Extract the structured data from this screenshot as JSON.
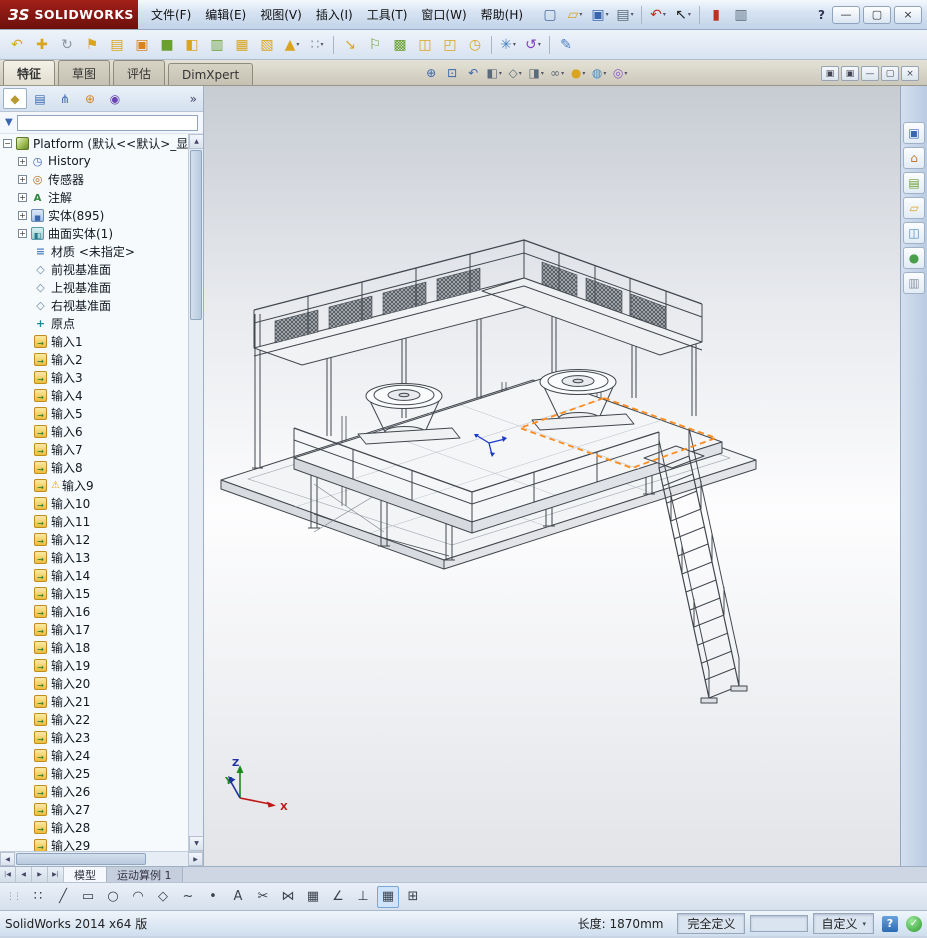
{
  "window": {
    "logo_mark": "ЗS",
    "logo_text": "SOLIDWORKS",
    "menus": [
      {
        "label": "文件(F)"
      },
      {
        "label": "编辑(E)"
      },
      {
        "label": "视图(V)"
      },
      {
        "label": "插入(I)"
      },
      {
        "label": "工具(T)"
      },
      {
        "label": "窗口(W)"
      },
      {
        "label": "帮助(H)"
      }
    ],
    "toolbar": [
      {
        "name": "new-file-icon",
        "glyph": "▢",
        "color": "#4a6a9a"
      },
      {
        "name": "open-file-icon",
        "glyph": "▱",
        "color": "#d9a520",
        "dd": true
      },
      {
        "name": "save-icon",
        "glyph": "▣",
        "color": "#3a66b0",
        "dd": true
      },
      {
        "name": "print-icon",
        "glyph": "▤",
        "color": "#5a6a7a",
        "dd": true
      },
      {
        "name": "separator",
        "sep": true
      },
      {
        "name": "undo-icon",
        "glyph": "↶",
        "color": "#c03020",
        "dd": true
      },
      {
        "name": "select-cursor-icon",
        "glyph": "↖",
        "color": "#222222",
        "dd": true
      },
      {
        "name": "separator",
        "sep": true
      },
      {
        "name": "rebuild-icon",
        "glyph": "▮",
        "color": "#c03020"
      },
      {
        "name": "clipboard-icon",
        "glyph": "▥",
        "color": "#5a6a7a"
      }
    ],
    "help_glyph": "?",
    "window_buttons": [
      {
        "name": "minimize-button",
        "glyph": "—"
      },
      {
        "name": "maximize-button",
        "glyph": "▢"
      },
      {
        "name": "close-button",
        "glyph": "×"
      }
    ]
  },
  "toolbar2": [
    {
      "name": "rollback-icon",
      "glyph": "↶",
      "color": "#d9a520"
    },
    {
      "name": "move-icon",
      "glyph": "✚",
      "color": "#d9a520"
    },
    {
      "name": "refresh-icon",
      "glyph": "↻",
      "color": "#8a96a4"
    },
    {
      "name": "flag-icon",
      "glyph": "⚑",
      "color": "#d9a520"
    },
    {
      "name": "document-icon",
      "glyph": "▤",
      "color": "#d9a520"
    },
    {
      "name": "box-icon",
      "glyph": "▣",
      "color": "#d98220"
    },
    {
      "name": "block-icon",
      "glyph": "■",
      "color": "#6aa030"
    },
    {
      "name": "half-section-icon",
      "glyph": "◧",
      "color": "#d9a520"
    },
    {
      "name": "panel-icon",
      "glyph": "▥",
      "color": "#6aa030"
    },
    {
      "name": "grid-icon",
      "glyph": "▦",
      "color": "#d9a520"
    },
    {
      "name": "hatch-icon",
      "glyph": "▧",
      "color": "#d9a520"
    },
    {
      "name": "triangle-icon",
      "glyph": "▲",
      "color": "#d9a520",
      "dd": true
    },
    {
      "name": "pattern-dots-icon",
      "glyph": "∷",
      "color": "#8a96a4",
      "dd": true
    },
    {
      "name": "separator",
      "sep": true
    },
    {
      "name": "arrow-icon",
      "glyph": "↘",
      "color": "#d9a520"
    },
    {
      "name": "flag2-icon",
      "glyph": "⚐",
      "color": "#6aa030"
    },
    {
      "name": "mesh-icon",
      "glyph": "▩",
      "color": "#6aa030"
    },
    {
      "name": "window-icon",
      "glyph": "◫",
      "color": "#d9a520"
    },
    {
      "name": "corner-icon",
      "glyph": "◰",
      "color": "#d9a520"
    },
    {
      "name": "clock-icon",
      "glyph": "◷",
      "color": "#d9a520"
    },
    {
      "name": "separator",
      "sep": true
    },
    {
      "name": "star-icon",
      "glyph": "✳",
      "color": "#4a7fc0",
      "dd": true
    },
    {
      "name": "loop-icon",
      "glyph": "↺",
      "color": "#8040c0",
      "dd": true
    },
    {
      "name": "separator",
      "sep": true
    },
    {
      "name": "pencil-icon",
      "glyph": "✎",
      "color": "#4a7fc0"
    }
  ],
  "command_tabs": [
    {
      "label": "特征",
      "active": true
    },
    {
      "label": "草图"
    },
    {
      "label": "评估"
    },
    {
      "label": "DimXpert"
    }
  ],
  "headsup": [
    {
      "name": "zoom-fit-icon",
      "glyph": "⊕",
      "color": "#3a66b0"
    },
    {
      "name": "zoom-area-icon",
      "glyph": "⊡",
      "color": "#3a66b0"
    },
    {
      "name": "previous-view-icon",
      "glyph": "↶",
      "color": "#3a66b0"
    },
    {
      "name": "section-view-icon",
      "glyph": "◧",
      "color": "#5a6a7a",
      "dd": true
    },
    {
      "name": "view-orientation-icon",
      "glyph": "◇",
      "color": "#5a6a7a",
      "dd": true
    },
    {
      "name": "display-style-icon",
      "glyph": "◨",
      "color": "#5a6a7a",
      "dd": true
    },
    {
      "name": "hide-show-items-icon",
      "glyph": "∞",
      "color": "#5a6a7a",
      "dd": true
    },
    {
      "name": "edit-appearance-icon",
      "glyph": "●",
      "color": "#d9a520",
      "dd": true
    },
    {
      "name": "apply-scene-icon",
      "glyph": "◍",
      "color": "#4a8ac0",
      "dd": true
    },
    {
      "name": "view-settings-icon",
      "glyph": "◎",
      "color": "#8a5ac0",
      "dd": true
    }
  ],
  "mdi_buttons": [
    {
      "name": "doc-restore-icon",
      "glyph": "▣"
    },
    {
      "name": "doc-new-window-icon",
      "glyph": "▣"
    },
    {
      "name": "doc-minimize-icon",
      "glyph": "—"
    },
    {
      "name": "doc-maximize-icon",
      "glyph": "▢"
    },
    {
      "name": "doc-close-icon",
      "glyph": "×"
    }
  ],
  "left_panel": {
    "tabs": [
      {
        "name": "featuremanager-tab",
        "glyph": "◆",
        "color": "#b89a30",
        "active": true
      },
      {
        "name": "propertymanager-tab",
        "glyph": "▤",
        "color": "#3a66b0"
      },
      {
        "name": "configurationmanager-tab",
        "glyph": "⋔",
        "color": "#3a66b0"
      },
      {
        "name": "dimxpertmanager-tab",
        "glyph": "⊕",
        "color": "#d98220"
      },
      {
        "name": "displaymanager-tab",
        "glyph": "◉",
        "color": "#6a44b0"
      }
    ],
    "chevron": "»",
    "funnel_glyph": "▼",
    "filter_value": "",
    "tree": [
      {
        "label": "Platform (默认<<默认>_显",
        "icon": "part",
        "expand": "minus",
        "root": true
      },
      {
        "label": "History",
        "icon": "history",
        "expand": "plus"
      },
      {
        "label": "传感器",
        "icon": "sensor",
        "expand": "plus"
      },
      {
        "label": "注解",
        "icon": "annot",
        "expand": "plus"
      },
      {
        "label": "实体(895)",
        "icon": "solids",
        "expand": "plus"
      },
      {
        "label": "曲面实体(1)",
        "icon": "surfs",
        "expand": "plus"
      },
      {
        "label": "材质 <未指定>",
        "icon": "material"
      },
      {
        "label": "前视基准面",
        "icon": "plane"
      },
      {
        "label": "上视基准面",
        "icon": "plane"
      },
      {
        "label": "右视基准面",
        "icon": "plane"
      },
      {
        "label": "原点",
        "icon": "origin"
      },
      {
        "label": "输入1",
        "icon": "import"
      },
      {
        "label": "输入2",
        "icon": "import"
      },
      {
        "label": "输入3",
        "icon": "import"
      },
      {
        "label": "输入4",
        "icon": "import"
      },
      {
        "label": "输入5",
        "icon": "import"
      },
      {
        "label": "输入6",
        "icon": "import"
      },
      {
        "label": "输入7",
        "icon": "import"
      },
      {
        "label": "输入8",
        "icon": "import"
      },
      {
        "label": "输入9",
        "icon": "import",
        "warn": true
      },
      {
        "label": "输入10",
        "icon": "import"
      },
      {
        "label": "输入11",
        "icon": "import"
      },
      {
        "label": "输入12",
        "icon": "import"
      },
      {
        "label": "输入13",
        "icon": "import"
      },
      {
        "label": "输入14",
        "icon": "import"
      },
      {
        "label": "输入15",
        "icon": "import"
      },
      {
        "label": "输入16",
        "icon": "import"
      },
      {
        "label": "输入17",
        "icon": "import"
      },
      {
        "label": "输入18",
        "icon": "import"
      },
      {
        "label": "输入19",
        "icon": "import"
      },
      {
        "label": "输入20",
        "icon": "import"
      },
      {
        "label": "输入21",
        "icon": "import"
      },
      {
        "label": "输入22",
        "icon": "import"
      },
      {
        "label": "输入23",
        "icon": "import"
      },
      {
        "label": "输入24",
        "icon": "import"
      },
      {
        "label": "输入25",
        "icon": "import"
      },
      {
        "label": "输入26",
        "icon": "import"
      },
      {
        "label": "输入27",
        "icon": "import"
      },
      {
        "label": "输入28",
        "icon": "import"
      },
      {
        "label": "输入29",
        "icon": "import"
      }
    ]
  },
  "viewport": {
    "triad": {
      "x": "X",
      "y": "Y",
      "z": "Z"
    }
  },
  "taskpane": [
    {
      "name": "solidworks-resources-icon",
      "glyph": "▣",
      "color": "#3a66b0"
    },
    {
      "name": "home-icon",
      "glyph": "⌂",
      "color": "#c07a30"
    },
    {
      "name": "design-library-icon",
      "glyph": "▤",
      "color": "#6aa030"
    },
    {
      "name": "file-explorer-icon",
      "glyph": "▱",
      "color": "#d9a520"
    },
    {
      "name": "view-palette-icon",
      "glyph": "◫",
      "color": "#4a8ac0"
    },
    {
      "name": "appearances-icon",
      "glyph": "●",
      "color": "#4aa04a"
    },
    {
      "name": "custom-properties-icon",
      "glyph": "▥",
      "color": "#8a96a4"
    }
  ],
  "doc_tabs": {
    "nav": [
      {
        "name": "scroll-first-tab-button",
        "glyph": "|◀"
      },
      {
        "name": "scroll-prev-tab-button",
        "glyph": "◀"
      },
      {
        "name": "scroll-next-tab-button",
        "glyph": "▶"
      },
      {
        "name": "scroll-last-tab-button",
        "glyph": "▶|"
      }
    ],
    "tabs": [
      {
        "label": "模型",
        "active": true
      },
      {
        "label": "运动算例 1"
      }
    ]
  },
  "sketchbar": [
    {
      "name": "sketch-select-icon",
      "glyph": "∷"
    },
    {
      "name": "sketch-line-icon",
      "glyph": "╱"
    },
    {
      "name": "sketch-rectangle-icon",
      "glyph": "▭"
    },
    {
      "name": "sketch-circle-icon",
      "glyph": "○"
    },
    {
      "name": "sketch-arc-icon",
      "glyph": "◠"
    },
    {
      "name": "sketch-polygon-icon",
      "glyph": "◇"
    },
    {
      "name": "sketch-spline-icon",
      "glyph": "~"
    },
    {
      "name": "sketch-point-icon",
      "glyph": "•"
    },
    {
      "name": "sketch-text-icon",
      "glyph": "A"
    },
    {
      "name": "sketch-trim-icon",
      "glyph": "✂"
    },
    {
      "name": "sketch-mirror-icon",
      "glyph": "⋈"
    },
    {
      "name": "sketch-pattern-icon",
      "glyph": "▦"
    },
    {
      "name": "sketch-dimension-icon",
      "glyph": "∠"
    },
    {
      "name": "sketch-relations-icon",
      "glyph": "⊥"
    },
    {
      "name": "grid-snap-icon",
      "glyph": "▦",
      "selected": true
    },
    {
      "name": "table-icon",
      "glyph": "⊞"
    }
  ],
  "status_bar": {
    "app_version": "SolidWorks 2014 x64 版",
    "length_label": "长度: 1870mm",
    "definition_status": "完全定义",
    "custom_label": "自定义",
    "help_glyph": "?",
    "check_glyph": "✓"
  }
}
